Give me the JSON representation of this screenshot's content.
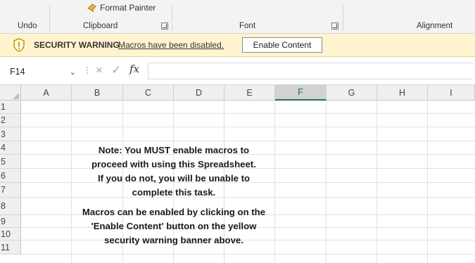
{
  "ribbon": {
    "format_painter_label": "Format Painter",
    "groups": [
      {
        "label": "Undo"
      },
      {
        "label": "Clipboard"
      },
      {
        "label": "Font"
      },
      {
        "label": "Alignment"
      }
    ]
  },
  "security_banner": {
    "title": "SECURITY WARNING",
    "message": "Macros have been disabled.",
    "button_label": "Enable Content",
    "color": "#fff4ce"
  },
  "formula_bar": {
    "name_box": "F14",
    "cancel_glyph": "×",
    "enter_glyph": "✓",
    "fx_label": "fx",
    "value": ""
  },
  "grid": {
    "columns": [
      "A",
      "B",
      "C",
      "D",
      "E",
      "F",
      "G",
      "H",
      "I"
    ],
    "active_column": "F",
    "rows": [
      "1",
      "2",
      "3",
      "4",
      "5",
      "6",
      "7",
      "8",
      "9",
      "10",
      "11"
    ],
    "accent_color": "#217346",
    "note": {
      "paragraph1": [
        "Note: You MUST enable macros to",
        "proceed with using this Spreadsheet.",
        "If you do not, you will be unable to",
        "complete this task."
      ],
      "paragraph2": [
        "Macros can be enabled by clicking on the",
        "'Enable Content' button on the yellow",
        "security warning banner above."
      ]
    }
  }
}
